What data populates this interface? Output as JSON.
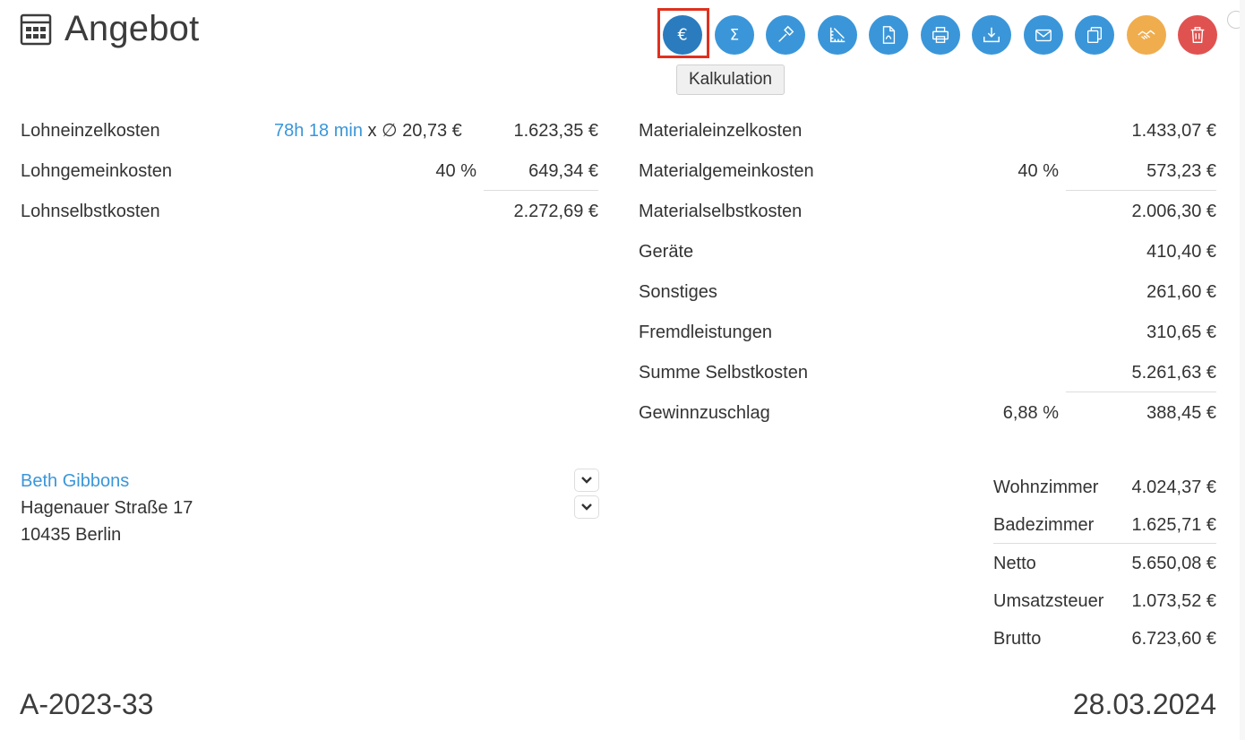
{
  "header": {
    "title": "Angebot"
  },
  "tooltip": "Kalkulation",
  "toolbar": [
    {
      "name": "kalkulation-button",
      "icon": "euro-icon"
    },
    {
      "name": "sum-button",
      "icon": "sigma-icon"
    },
    {
      "name": "tools-button",
      "icon": "hammer-icon"
    },
    {
      "name": "measure-button",
      "icon": "ruler-icon"
    },
    {
      "name": "pdf-button",
      "icon": "pdf-icon"
    },
    {
      "name": "print-button",
      "icon": "printer-icon"
    },
    {
      "name": "download-button",
      "icon": "download-icon"
    },
    {
      "name": "email-button",
      "icon": "envelope-icon"
    },
    {
      "name": "copy-button",
      "icon": "copy-icon"
    },
    {
      "name": "accept-button",
      "icon": "handshake-icon"
    },
    {
      "name": "delete-button",
      "icon": "trash-icon"
    }
  ],
  "colors": {
    "primary": "#3a96d9",
    "orange": "#f0ad4e",
    "red": "#e05250",
    "highlight": "#e0301e"
  },
  "labor": {
    "einzel_label": "Lohneinzelkosten",
    "einzel_time": "78h 18 min",
    "einzel_rate": "x ∅ 20,73 €",
    "einzel_value": "1.623,35 €",
    "gemein_label": "Lohngemeinkosten",
    "gemein_pct": "40 %",
    "gemein_value": "649,34 €",
    "selbst_label": "Lohnselbstkosten",
    "selbst_value": "2.272,69 €"
  },
  "material": {
    "einzel_label": "Materialeinzelkosten",
    "einzel_value": "1.433,07 €",
    "gemein_label": "Materialgemeinkosten",
    "gemein_pct": "40 %",
    "gemein_value": "573,23 €",
    "selbst_label": "Materialselbstkosten",
    "selbst_value": "2.006,30 €",
    "geraete_label": "Geräte",
    "geraete_value": "410,40 €",
    "sonstiges_label": "Sonstiges",
    "sonstiges_value": "261,60 €",
    "fremd_label": "Fremdleistungen",
    "fremd_value": "310,65 €",
    "summe_label": "Summe Selbstkosten",
    "summe_value": "5.261,63 €",
    "gewinn_label": "Gewinnzuschlag",
    "gewinn_pct": "6,88 %",
    "gewinn_value": "388,45 €"
  },
  "customer": {
    "name": "Beth Gibbons",
    "street": "Hagenauer Straße 17",
    "city": "10435 Berlin"
  },
  "totals": {
    "wohn_label": "Wohnzimmer",
    "wohn_value": "4.024,37 €",
    "bad_label": "Badezimmer",
    "bad_value": "1.625,71 €",
    "netto_label": "Netto",
    "netto_value": "5.650,08 €",
    "ust_label": "Umsatzsteuer",
    "ust_value": "1.073,52 €",
    "brutto_label": "Brutto",
    "brutto_value": "6.723,60 €"
  },
  "footer": {
    "number": "A-2023-33",
    "date": "28.03.2024"
  }
}
